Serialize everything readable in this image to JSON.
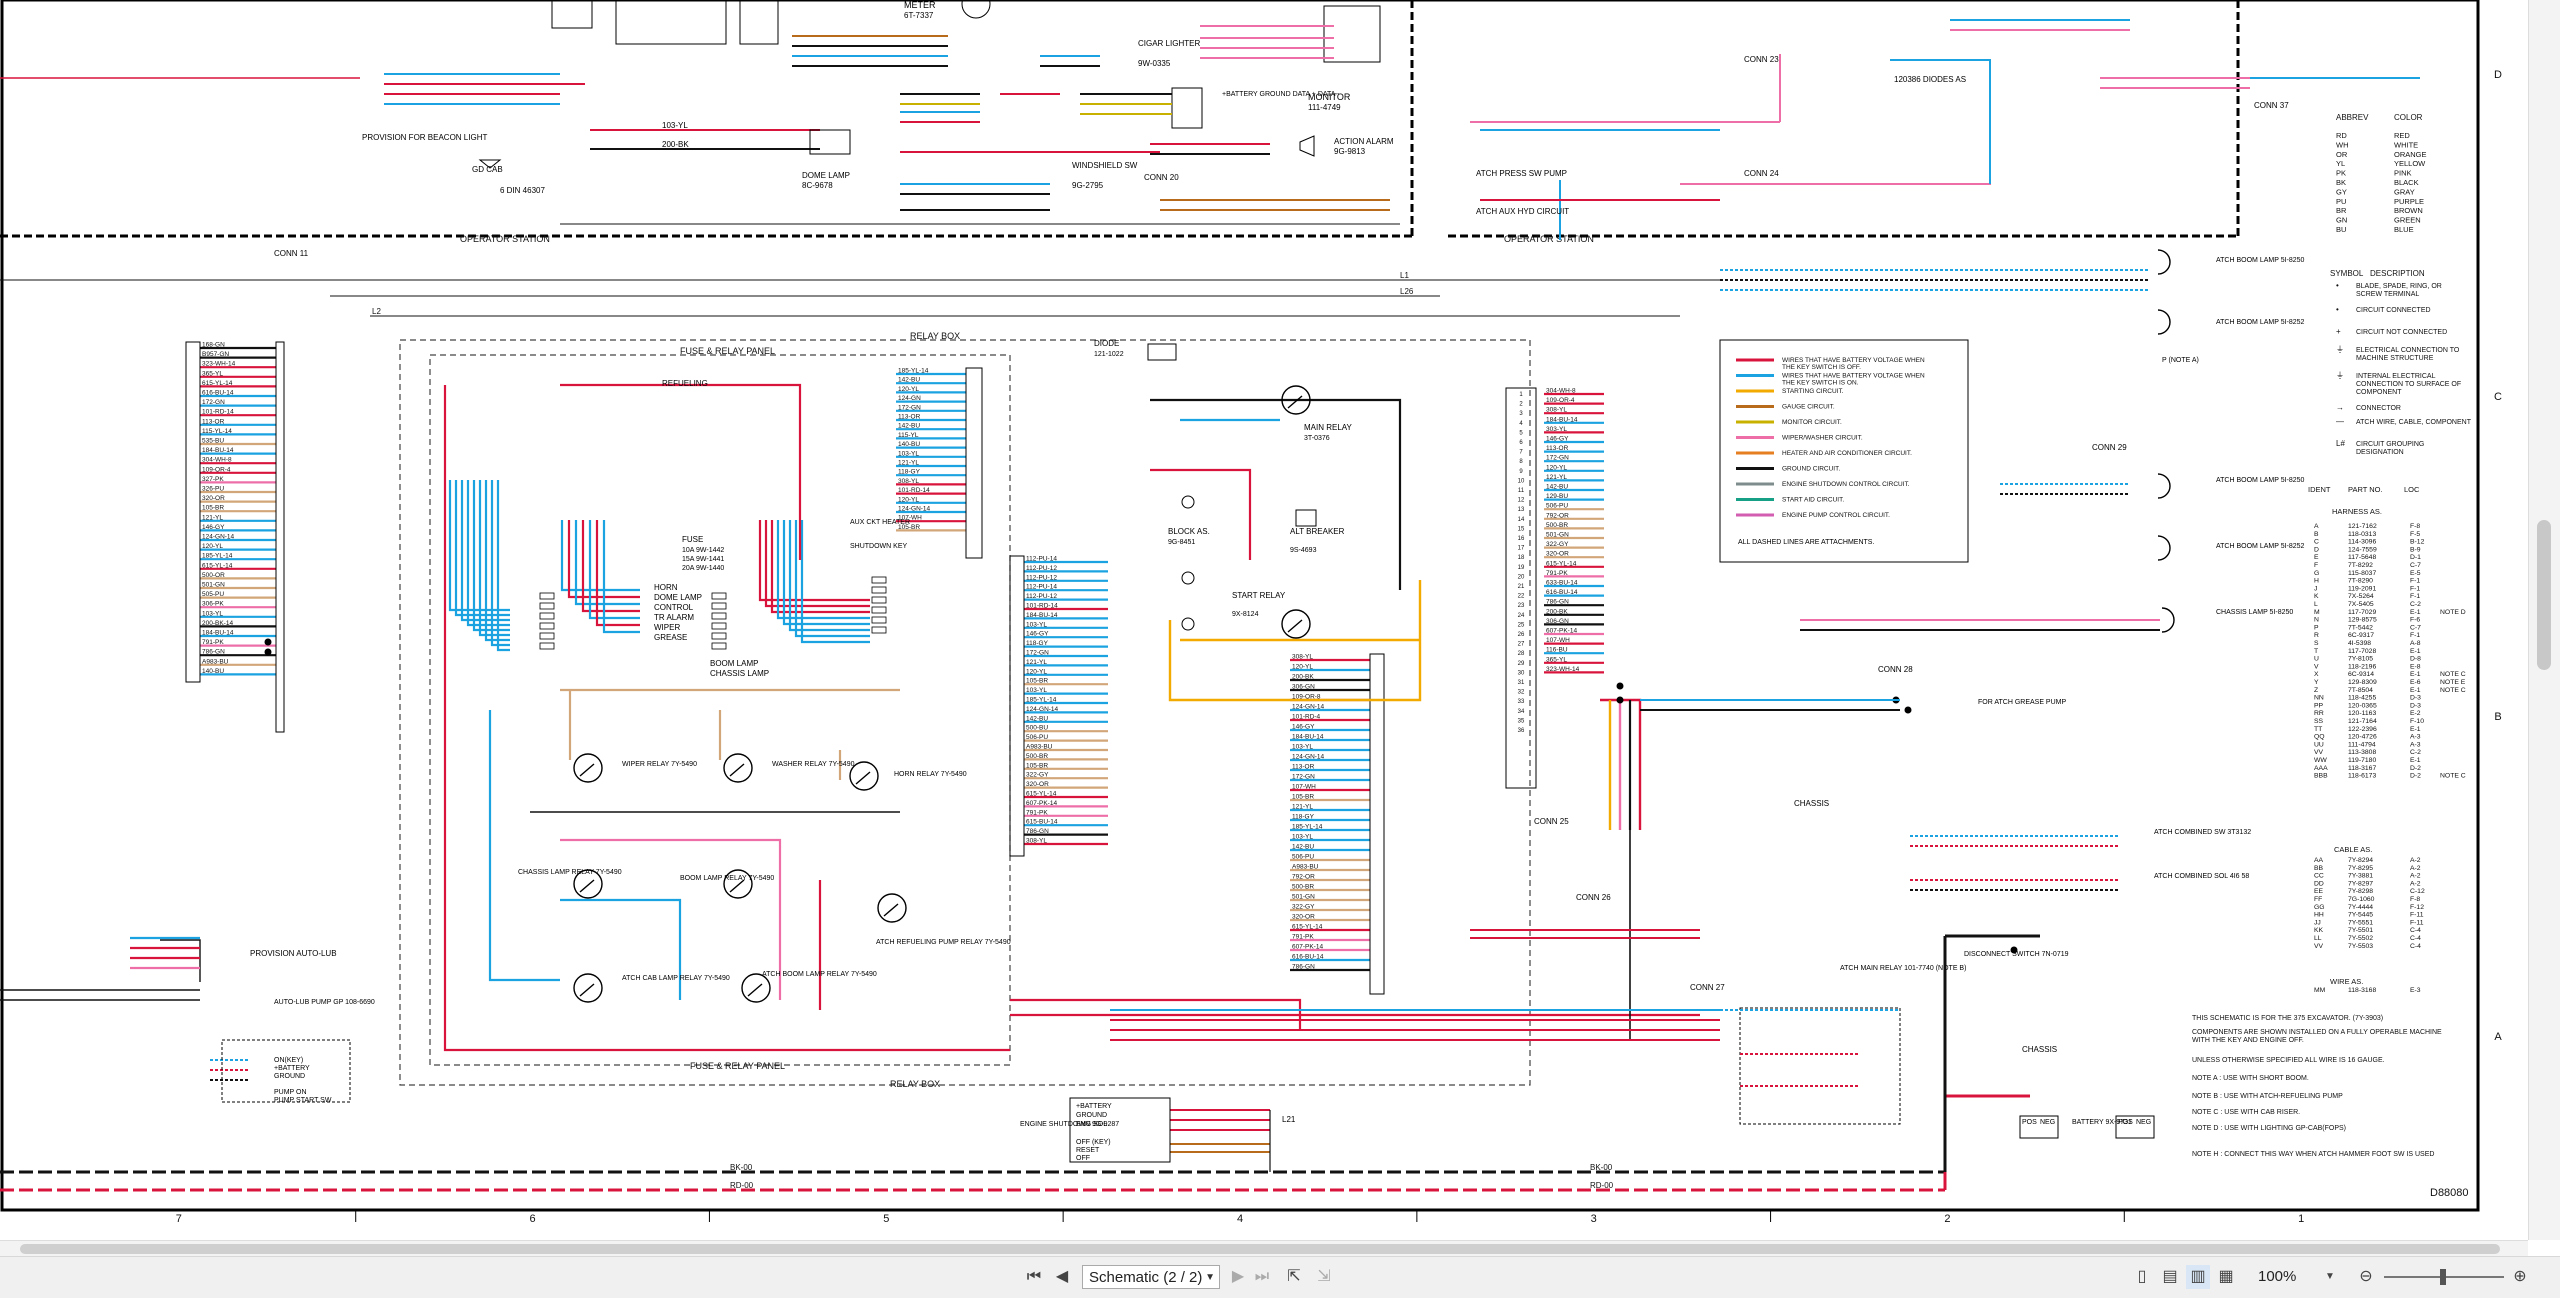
{
  "drawing": {
    "number": "D88080",
    "zone_columns": [
      "7",
      "6",
      "5",
      "4",
      "3",
      "2",
      "1"
    ],
    "zone_rows": [
      "D",
      "C",
      "B",
      "A"
    ],
    "station_labels": {
      "operator_station": "OPERATOR STATION",
      "relay_box": "RELAY BOX",
      "fuse_relay_panel": "FUSE & RELAY PANEL",
      "dashed_relay_box": "RELAY BOX",
      "dashed_fuse_panel": "FUSE & RELAY PANEL"
    }
  },
  "components": {
    "conn11": "CONN 11",
    "conn20": "CONN 20",
    "conn23": "CONN 23",
    "conn24": "CONN 24",
    "conn25": "CONN 25",
    "conn26": "CONN 26",
    "conn27": "CONN 27",
    "conn28": "CONN 28",
    "conn29": "CONN 29",
    "conn37": "CONN 37",
    "meter": "METER",
    "meter_pn": "6T-7337",
    "cigar": "CIGAR LIGHTER",
    "cigar_pn": "9W-0335",
    "monitor": "MONITOR",
    "monitor_pn": "111-4749",
    "action_alarm": "ACTION ALARM",
    "action_alarm_pn": "9G-9813",
    "dome_lamp": "DOME LAMP",
    "dome_lamp_pn": "8C-9678",
    "windshield": "WINDSHIELD SW",
    "windshield_pn": "9G-2795",
    "beacon": "PROVISION FOR BEACON LIGHT",
    "gd_cab": "GD CAB",
    "din": "6 DIN 46307",
    "diode": "DIODE",
    "diode_pn": "121-1022",
    "main_relay": "MAIN RELAY",
    "main_relay_pn": "3T-0376",
    "block": "BLOCK AS.",
    "block_pn": "9G-8451",
    "alt_breaker": "ALT BREAKER",
    "alt_breaker_pn": "9S-4693",
    "start_relay": "START RELAY",
    "start_relay_pn": "9X-8124",
    "fuse_label": "FUSE",
    "fuse_a": "10A 9W-1442",
    "fuse_b": "15A 9W-1441",
    "fuse_c": "20A 9W-1440",
    "refueling": "REFUELING",
    "aux_heater": "AUX CKT HEATER",
    "shutdown_key": "SHUTDOWN KEY",
    "horn": "HORN",
    "dome_lamp2": "DOME LAMP",
    "control": "CONTROL",
    "tr_alarm": "TR ALARM",
    "wiper": "WIPER",
    "grease": "GREASE",
    "boom_lamp": "BOOM LAMP",
    "chassis_lamp": "CHASSIS LAMP",
    "wiper_relay": "WIPER RELAY 7Y-5490",
    "washer_relay": "WASHER RELAY 7Y-5490",
    "horn_relay": "HORN RELAY 7Y-5490",
    "chassis_lamp_relay": "CHASSIS LAMP RELAY 7Y-5490",
    "boom_lamp_relay": "BOOM LAMP RELAY 7Y-5490",
    "atch_cab_lamp_relay": "ATCH CAB LAMP RELAY 7Y-5490",
    "atch_boom_lamp_relay": "ATCH BOOM LAMP RELAY 7Y-5490",
    "atch_refueling": "ATCH REFUELING PUMP RELAY 7Y-5490",
    "provision_autolub": "PROVISION AUTO-LUB",
    "autolub_pump": "AUTO-LUB PUMP GP 108-6690",
    "on_key": "ON(KEY)",
    "plus_battery": "+BATTERY",
    "ground": "GROUND",
    "pump_on": "PUMP ON",
    "pump_start": "PUMP START SW",
    "engine_shutdown": "ENGINE SHUTDOWN 9G-9287",
    "eng_plus_battery": "+BATTERY",
    "eng_ground": "GROUND",
    "eng_sol": "ENG SOL",
    "off_key": "OFF (KEY)",
    "reset": "RESET",
    "off": "OFF",
    "atch_main_relay": "ATCH MAIN RELAY 101-7740 (NOTE B)",
    "disconnect": "DISCONNECT SWITCH 7N-0719",
    "chassis": "CHASSIS",
    "battery": "BATTERY 9X-9731",
    "pos": "POS",
    "neg": "NEG",
    "atch_combined_sw": "ATCH COMBINED SW 3T3132",
    "atch_combined_sol": "ATCH COMBINED SOL 4I6 58",
    "for_atch_grease": "FOR ATCH GREASE PUMP",
    "atch_press_sw": "ATCH PRESS SW PUMP",
    "atch_aux_hyd": "ATCH AUX HYD CIRCUIT",
    "diodes": "120386 DIODES AS",
    "atch_boom_lamp_a": "ATCH BOOM LAMP 5I-8250",
    "atch_boom_lamp_b": "ATCH BOOM LAMP 5I-8252",
    "chassis_lamp_r": "CHASSIS LAMP 5I-8250",
    "note_a": "P (NOTE A)",
    "monitor_bat": "+BATTERY GROUND DATA + DATA -"
  },
  "wire_legend": [
    {
      "label": "WIRES THAT HAVE BATTERY VOLTAGE WHEN THE KEY SWITCH IS OFF.",
      "color": "#d8143c"
    },
    {
      "label": "WIRES THAT HAVE BATTERY VOLTAGE WHEN THE KEY SWITCH IS ON.",
      "color": "#1aa3e0"
    },
    {
      "label": "STARTING CIRCUIT.",
      "color": "#f2a900"
    },
    {
      "label": "GAUGE CIRCUIT.",
      "color": "#b86b1b"
    },
    {
      "label": "MONITOR CIRCUIT.",
      "color": "#c9b100"
    },
    {
      "label": "WIPER/WASHER CIRCUIT.",
      "color": "#ee6fa8"
    },
    {
      "label": "HEATER AND AIR CONDITIONER CIRCUIT.",
      "color": "#e67e22"
    },
    {
      "label": "GROUND CIRCUIT.",
      "color": "#111111"
    },
    {
      "label": "ENGINE SHUTDOWN CONTROL CIRCUIT.",
      "color": "#7f8c8d"
    },
    {
      "label": "START AID CIRCUIT.",
      "color": "#16a085"
    },
    {
      "label": "ENGINE PUMP CONTROL CIRCUIT.",
      "color": "#d35db0"
    }
  ],
  "wire_legend_note": "ALL DASHED LINES ARE ATTACHMENTS.",
  "color_table": {
    "headers": [
      "ABBREV",
      "COLOR"
    ],
    "rows": [
      [
        "RD",
        "RED"
      ],
      [
        "WH",
        "WHITE"
      ],
      [
        "OR",
        "ORANGE"
      ],
      [
        "YL",
        "YELLOW"
      ],
      [
        "PK",
        "PINK"
      ],
      [
        "BK",
        "BLACK"
      ],
      [
        "GY",
        "GRAY"
      ],
      [
        "PU",
        "PURPLE"
      ],
      [
        "BR",
        "BROWN"
      ],
      [
        "GN",
        "GREEN"
      ],
      [
        "BU",
        "BLUE"
      ]
    ]
  },
  "symbol_table": {
    "headers": [
      "SYMBOL",
      "DESCRIPTION"
    ],
    "rows": [
      [
        "BLADE, SPADE, RING, OR SCREW TERMINAL"
      ],
      [
        "CIRCUIT CONNECTED"
      ],
      [
        "CIRCUIT NOT CONNECTED"
      ],
      [
        "ELECTRICAL CONNECTION TO MACHINE STRUCTURE"
      ],
      [
        "INTERNAL ELECTRICAL CONNECTION TO SURFACE OF COMPONENT"
      ],
      [
        "CONNECTOR"
      ],
      [
        "ATCH WIRE, CABLE, COMPONENT"
      ],
      [
        "CIRCUIT GROUPING DESIGNATION"
      ]
    ]
  },
  "harness_table": {
    "headers": [
      "IDENT",
      "PART NO.",
      "LOC"
    ],
    "title": "HARNESS AS.",
    "rows": [
      [
        "A",
        "121-7162",
        "F-8",
        ""
      ],
      [
        "B",
        "118-0313",
        "F-5",
        ""
      ],
      [
        "C",
        "114-3096",
        "B-12",
        ""
      ],
      [
        "D",
        "124-7559",
        "B-9",
        ""
      ],
      [
        "E",
        "117-5648",
        "D-1",
        ""
      ],
      [
        "F",
        "7T-8292",
        "C-7",
        ""
      ],
      [
        "G",
        "115-8037",
        "E-5",
        ""
      ],
      [
        "H",
        "7T-8290",
        "F-1",
        ""
      ],
      [
        "J",
        "119-2091",
        "F-1",
        ""
      ],
      [
        "K",
        "7X-5264",
        "F-1",
        ""
      ],
      [
        "L",
        "7X-5405",
        "C-2",
        ""
      ],
      [
        "M",
        "117-7029",
        "E-1",
        "NOTE D"
      ],
      [
        "N",
        "129-8575",
        "F-6",
        ""
      ],
      [
        "P",
        "7T-5442",
        "C-7",
        ""
      ],
      [
        "R",
        "6C-9317",
        "F-1",
        ""
      ],
      [
        "S",
        "4I-5398",
        "A-8",
        ""
      ],
      [
        "T",
        "117-7028",
        "E-1",
        ""
      ],
      [
        "U",
        "7Y-8105",
        "D-8",
        ""
      ],
      [
        "V",
        "118-2196",
        "E-8",
        ""
      ],
      [
        "X",
        "6C-9314",
        "E-1",
        "NOTE C"
      ],
      [
        "Y",
        "129-8309",
        "E-6",
        "NOTE E"
      ],
      [
        "Z",
        "7T-8504",
        "E-1",
        "NOTE C"
      ],
      [
        "NN",
        "118-4255",
        "D-3",
        ""
      ],
      [
        "PP",
        "120-0365",
        "D-3",
        ""
      ],
      [
        "RR",
        "120-1163",
        "E-2",
        ""
      ],
      [
        "SS",
        "121-7164",
        "F-10",
        ""
      ],
      [
        "TT",
        "122-2396",
        "E-1",
        ""
      ],
      [
        "QQ",
        "120-4726",
        "A-3",
        ""
      ],
      [
        "UU",
        "111-4794",
        "A-3",
        ""
      ],
      [
        "VV",
        "113-3808",
        "C-2",
        ""
      ],
      [
        "WW",
        "119-7180",
        "E-1",
        ""
      ],
      [
        "AAA",
        "118-3167",
        "D-2",
        ""
      ],
      [
        "BBB",
        "118-6173",
        "D-2",
        "NOTE C"
      ]
    ]
  },
  "cable_table": {
    "title": "CABLE AS.",
    "rows": [
      [
        "AA",
        "7Y-8294",
        "A-2"
      ],
      [
        "BB",
        "7Y-8295",
        "A-2"
      ],
      [
        "CC",
        "7Y-3881",
        "A-2"
      ],
      [
        "DD",
        "7Y-8297",
        "A-2"
      ],
      [
        "EE",
        "7Y-8298",
        "C-12"
      ],
      [
        "FF",
        "7G-1060",
        "F-8"
      ],
      [
        "GG",
        "7Y-4444",
        "F-12"
      ],
      [
        "HH",
        "7Y-5445",
        "F-11"
      ],
      [
        "JJ",
        "7Y-5551",
        "F-11"
      ],
      [
        "KK",
        "7Y-5501",
        "C-4"
      ],
      [
        "LL",
        "7Y-5502",
        "C-4"
      ],
      [
        "VV",
        "7Y-5503",
        "C-4"
      ]
    ]
  },
  "wire_as": {
    "title": "WIRE AS.",
    "row": [
      "MM",
      "118-3168",
      "E-3"
    ]
  },
  "notes": [
    "THIS SCHEMATIC IS FOR THE 375 EXCAVATOR. (7Y-3903)",
    "COMPONENTS ARE SHOWN INSTALLED ON A FULLY OPERABLE MACHINE WITH THE KEY AND ENGINE OFF.",
    "UNLESS OTHERWISE SPECIFIED ALL WIRE IS 16 GAUGE.",
    "NOTE A : USE WITH SHORT BOOM.",
    "NOTE B : USE WITH ATCH-REFUELING PUMP",
    "NOTE C : USE WITH CAB RISER.",
    "NOTE D : USE WITH LIGHTING GP-CAB(FOPS)",
    "NOTE H : CONNECT THIS WAY WHEN ATCH HAMMER FOOT SW IS USED"
  ],
  "bus_labels": {
    "bk00": "BK-00",
    "rd00": "RD-00",
    "l1": "L1",
    "l2": "L2",
    "l26": "L26",
    "l20": "L20",
    "l21": "L21",
    "l25": "L25",
    "l29": "L29"
  },
  "wire_columns": {
    "left_conn": [
      "168-GN",
      "B957-GN",
      "323-WH-14",
      "365-YL",
      "615-YL-14",
      "616-BU-14",
      "172-GN",
      "101-RD-14",
      "113-OR",
      "115-YL-14",
      "535-BU",
      "184-BU-14",
      "304-WH-8",
      "109-OR-4",
      "327-PK",
      "326-PU",
      "320-OR",
      "105-BR",
      "121-YL",
      "146-GY",
      "124-GN-14",
      "120-YL",
      "185-YL-14",
      "615-YL-14",
      "500-OR",
      "501-GN",
      "505-PU",
      "306-PK",
      "103-YL",
      "200-BK-14",
      "184-BU-14",
      "791-PK",
      "786-GN",
      "A983-BU",
      "140-BU"
    ],
    "relay_center": [
      "185-YL-14",
      "142-BU",
      "120-YL",
      "124-GN",
      "172-GN",
      "113-OR",
      "142-BU",
      "115-YL",
      "140-BU",
      "103-YL",
      "121-YL",
      "118-GY",
      "308-YL",
      "101-RD-14",
      "120-YL",
      "124-GN-14",
      "107-WH",
      "105-BR"
    ],
    "relay_lower": [
      "112-PU-14",
      "112-PU-12",
      "112-PU-12",
      "112-PU-14",
      "112-PU-12",
      "101-RD-14",
      "184-BU-14",
      "103-YL",
      "146-GY",
      "118-GY",
      "172-GN",
      "121-YL",
      "120-YL",
      "105-BR",
      "103-YL",
      "185-YL-14",
      "124-GN-14",
      "142-BU",
      "500-BU",
      "506-PU",
      "A983-BU",
      "500-BR",
      "105-BR",
      "322-GY",
      "320-OR",
      "615-YL-14",
      "607-PK-14",
      "791-PK",
      "615-BU-14",
      "786-GN",
      "308-YL"
    ],
    "conn25": [
      "304-WH-8",
      "109-OR-4",
      "308-YL",
      "184-BU-14",
      "303-YL",
      "146-GY",
      "113-OR",
      "172-GN",
      "120-YL",
      "121-YL",
      "142-BU",
      "129-BU",
      "506-PU",
      "792-OR",
      "500-BR",
      "501-GN",
      "322-GY",
      "320-OR",
      "615-YL-14",
      "791-PK",
      "633-BU-14",
      "616-BU-14",
      "786-GN",
      "200-BK",
      "306-GN",
      "607-PK-14",
      "107-WH",
      "116-BU",
      "365-YL",
      "323-WH-14"
    ],
    "start_relay_col": [
      "308-YL",
      "120-YL",
      "200-BK",
      "306-GN",
      "109-OR-8",
      "124-GN-14",
      "101-RD-4",
      "146-GY",
      "184-BU-14",
      "103-YL",
      "124-GN-14",
      "113-OR",
      "172-GN",
      "107-WH",
      "105-BR",
      "121-YL",
      "118-GY",
      "185-YL-14",
      "103-YL",
      "142-BU",
      "506-PU",
      "A983-BU",
      "792-OR",
      "500-BR",
      "501-GN",
      "322-GY",
      "320-OR",
      "615-YL-14",
      "791-PK",
      "607-PK-14",
      "616-BU-14",
      "786-GN"
    ]
  },
  "toolbar": {
    "page_select": "Schematic (2 / 2)",
    "zoom": "100%"
  }
}
